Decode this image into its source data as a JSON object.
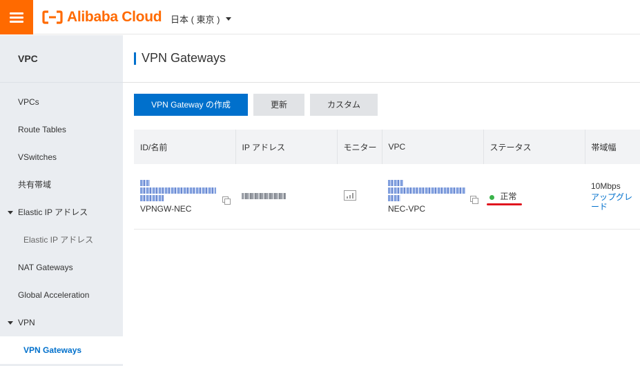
{
  "header": {
    "logo_text": "Alibaba Cloud",
    "region": "日本 ( 東京 )",
    "brand_color": "#ff6a00"
  },
  "sidebar": {
    "title": "VPC",
    "items": [
      {
        "label": "VPCs"
      },
      {
        "label": "Route Tables"
      },
      {
        "label": "VSwitches"
      },
      {
        "label": "共有帯域"
      },
      {
        "label": "Elastic IP アドレス"
      },
      {
        "label": "Elastic IP アドレス"
      },
      {
        "label": "NAT Gateways"
      },
      {
        "label": "Global Acceleration"
      },
      {
        "label": "VPN"
      },
      {
        "label": "VPN Gateways"
      }
    ]
  },
  "main": {
    "title": "VPN Gateways",
    "toolbar": {
      "create_label": "VPN Gateway の作成",
      "refresh_label": "更新",
      "custom_label": "カスタム"
    },
    "table": {
      "columns": [
        "ID/名前",
        "IP アドレス",
        "モニター",
        "VPC",
        "ステータス",
        "帯域幅"
      ],
      "rows": [
        {
          "name": "VPNGW-NEC",
          "vpc_name": "NEC-VPC",
          "status": "正常",
          "bandwidth": "10Mbps",
          "action": "アップグレード"
        }
      ]
    }
  },
  "colors": {
    "accent": "#0070cc",
    "status_ok": "#3ab34a",
    "annotation": "#e0141e"
  }
}
